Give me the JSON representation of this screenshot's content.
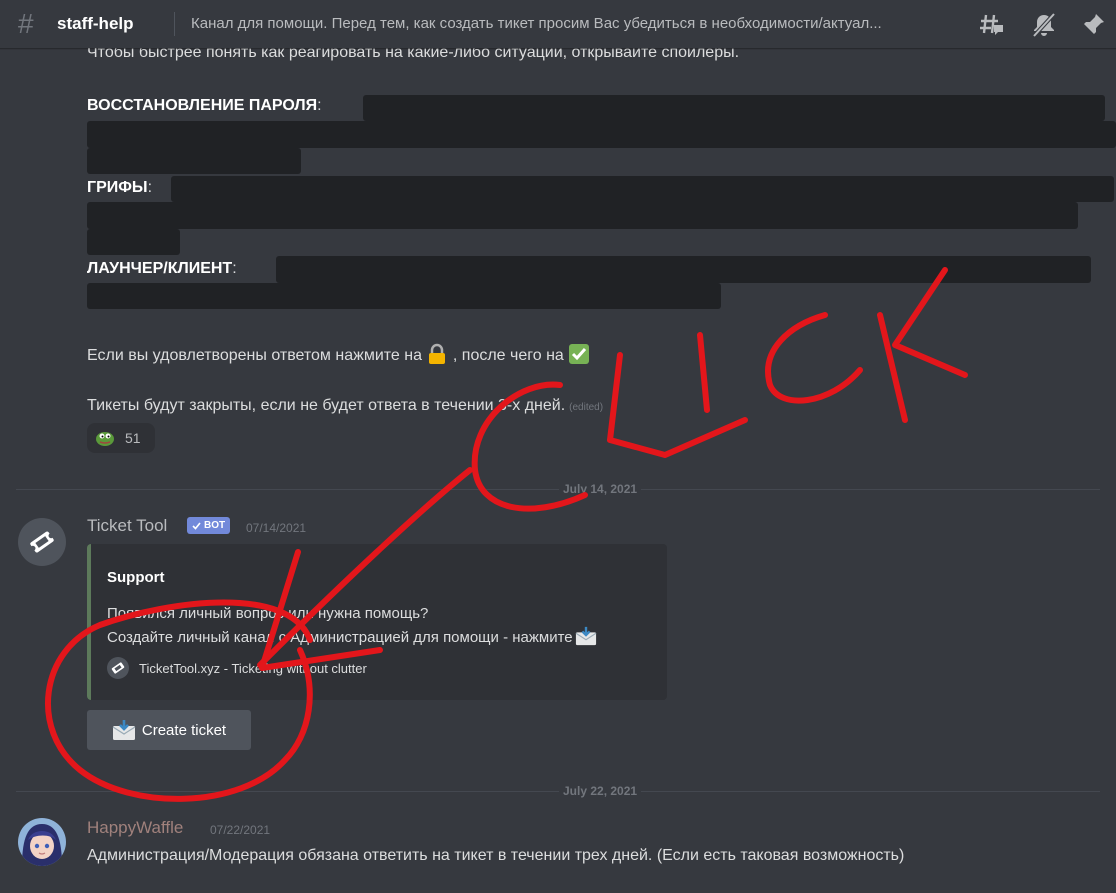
{
  "header": {
    "channel_name": "staff-help",
    "topic": "Канал для помощи. Перед тем, как создать тикет просим Вас убедиться в необходимости/актуал..."
  },
  "intro_message": {
    "first_line": "Чтобы быстрее понять как реагировать на какие-либо ситуации, открывайте спойлеры.",
    "section_password": "ВОССТАНОВЛЕНИЕ ПАРОЛЯ",
    "section_griefs": "ГРИФЫ",
    "section_launcher": "ЛАУНЧЕР/КЛИЕНТ",
    "colon": ":",
    "satisfied_line_a": "Если вы удовлетворены ответом нажмите на",
    "satisfied_line_b": ", после чего на",
    "closing_line": "Тикеты будут закрыты, если не будет ответа в течении 3-х дней.",
    "edited": "(edited)",
    "reaction_count": "51"
  },
  "divider_1": {
    "date": "July 14, 2021"
  },
  "bot_message": {
    "username": "Ticket Tool",
    "bot_tag": "BOT",
    "timestamp": "07/14/2021",
    "embed_title": "Support",
    "embed_line_1": "Появился личный вопрос или нужна помощь?",
    "embed_line_2": "Создайте личный канал с Администрацией для помощи - нажмите",
    "embed_footer": "TicketTool.xyz - Ticketing without clutter",
    "button_label": "Create ticket"
  },
  "divider_2": {
    "date": "July 22, 2021"
  },
  "user_message": {
    "username": "HappyWaffle",
    "timestamp": "07/22/2021",
    "text": "Администрация/Модерация обязана ответить на тикет в течении трех дней. (Если есть таковая возможность)"
  },
  "annotation": {
    "word": "CLICK",
    "color": "#e3161b"
  },
  "colors": {
    "background": "#36393f",
    "spoiler": "#202225",
    "embed": "#2f3136",
    "embed_accent": "#5d7a5b",
    "button": "#4f545c",
    "bot_tag": "#7289da",
    "bot_name": "#b9bbbe",
    "user_name": "#a0817c"
  },
  "icons": [
    "hash-icon",
    "threads-icon",
    "mute-bell-icon",
    "pin-icon",
    "lock-emoji",
    "check-emoji",
    "pepe-emoji",
    "ticket-icon",
    "envelope-inbox-icon"
  ]
}
